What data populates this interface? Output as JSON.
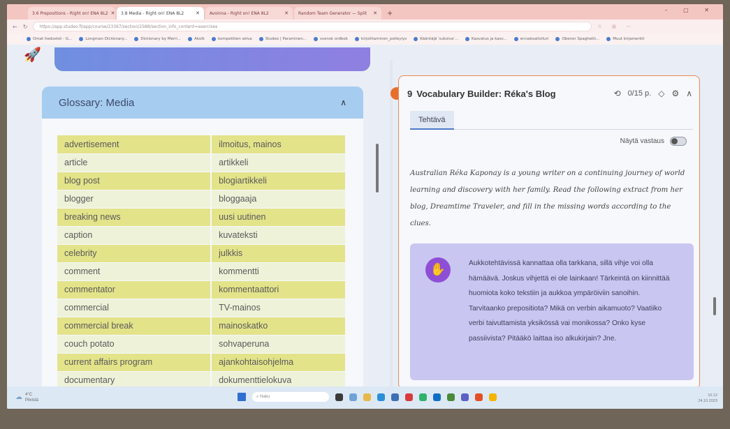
{
  "browser": {
    "tabs": [
      {
        "label": "3.6 Prepositions - Right on! ENA 8L2",
        "active": false
      },
      {
        "label": "3.8 Media - Right on! ENA 8L2",
        "active": true
      },
      {
        "label": "Avoinna - Right on! ENA 8L2",
        "active": false
      },
      {
        "label": "Random Team Generator — Split",
        "active": false
      }
    ],
    "new_tab": "+",
    "window_controls": "– ▢ ✕",
    "url": "https://app.studeo.fi/app/course/23397/section/2588/section_info_content=exercises",
    "bookmarks": [
      "Omat tiedostot - G...",
      "Longman Dictionary...",
      "Dictionary by Merri...",
      "Akolk",
      "kompetitien wiiva",
      "Studeo | Paraminen...",
      "svensk ordbok",
      "kirjoittaminen_pelleyiys",
      "Kääntäjä 'suksiva'...",
      "Kasvatus ja kasv...",
      "ennakoaitoiluri",
      "Oberon Spaghetti...",
      "Muut kirjamerkit"
    ]
  },
  "glossary": {
    "title": "Glossary: Media",
    "rows": [
      {
        "en": "advertisement",
        "fi": "ilmoitus, mainos"
      },
      {
        "en": "article",
        "fi": "artikkeli"
      },
      {
        "en": "blog post",
        "fi": "blogiartikkeli"
      },
      {
        "en": "blogger",
        "fi": "bloggaaja"
      },
      {
        "en": "breaking news",
        "fi": "uusi uutinen"
      },
      {
        "en": "caption",
        "fi": "kuvateksti"
      },
      {
        "en": "celebrity",
        "fi": "julkkis"
      },
      {
        "en": "comment",
        "fi": "kommentti"
      },
      {
        "en": "commentator",
        "fi": "kommentaattori"
      },
      {
        "en": "commercial",
        "fi": "TV-mainos"
      },
      {
        "en": "commercial break",
        "fi": "mainoskatko"
      },
      {
        "en": "couch potato",
        "fi": "sohvaperuna"
      },
      {
        "en": "current affairs program",
        "fi": "ajankohtaisohjelma"
      },
      {
        "en": "documentary",
        "fi": "dokumenttielokuva"
      }
    ]
  },
  "exercise": {
    "number": "9",
    "title": "Vocabulary Builder: Réka's Blog",
    "score": "0/15 p.",
    "tab_label": "Tehtävä",
    "toggle_label": "Näytä vastaus",
    "instructions": "Australian Réka Kaponay is a young writer on a continuing journey of world learning and discovery with her family. Read the following extract from her blog, Dreamtime Traveler, and fill in the missing words according to the clues.",
    "hint": "Aukkotehtävissä kannattaa olla tarkkana, sillä vihje voi olla hämäävä. Joskus vihjettä ei ole lainkaan! Tärkeintä on kiinnittää huomiota koko tekstiin ja aukkoa ympäröiviin sanoihin. Tarvitaanko prepositiota? Mikä on verbin aikamuoto? Vaatiiko verbi taivuttamista yksikössä vai monikossa? Onko kyse passiivista? Pitääkö laittaa iso alkukirjain? Jne."
  },
  "taskbar": {
    "weather_temp": "4°C",
    "weather_desc": "Pilvistä",
    "search_placeholder": "Haku",
    "time": "10.12",
    "date": "24.10.2023"
  }
}
